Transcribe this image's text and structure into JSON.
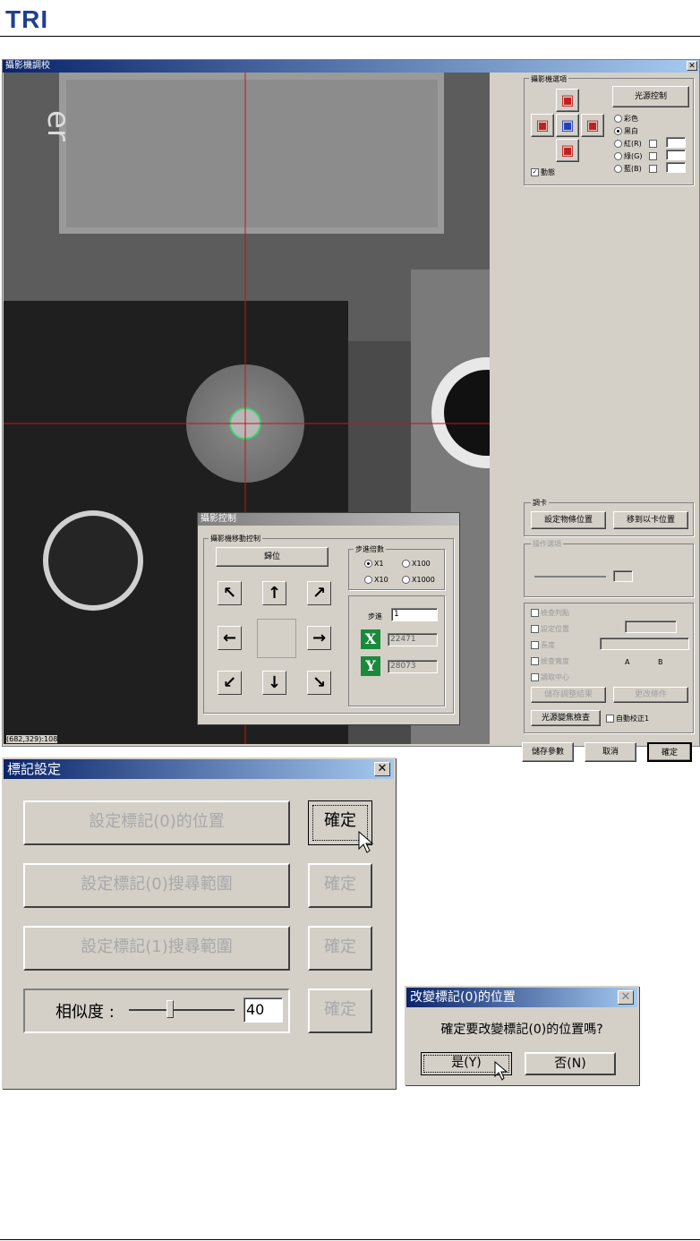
{
  "header": {
    "logo": "TRI"
  },
  "main_window": {
    "title": "攝影機調校",
    "status": "(682,329):108",
    "camera_options": {
      "group_label": "攝影機選項",
      "light_button": "光源控制",
      "color_modes": [
        "彩色",
        "黑白",
        "紅(R)",
        "綠(G)",
        "藍(B)"
      ],
      "selected_mode": "黑白",
      "dynamic_label": "動態"
    },
    "calibration": {
      "group_label": "調卡",
      "set_position_button": "設定物條位置",
      "move_center_button": "移到以卡位置"
    },
    "tool_group": {
      "label": "操作選項",
      "options": [
        "檢查判點",
        "設定位置",
        "長度",
        "檢查寬度",
        "讀取中心"
      ],
      "labels_ab": [
        "A",
        "B"
      ],
      "disabled_btn1": "儲存調整結果",
      "disabled_btn2": "更改條件",
      "light_test_button": "光源變焦檢查",
      "auto_label": "自動校正1"
    },
    "bottom_buttons": {
      "save": "儲存參數",
      "cancel": "取消",
      "ok": "確定"
    }
  },
  "motion_dialog": {
    "title": "攝影控制",
    "group_label": "攝影機移動控制",
    "home_button": "歸位",
    "step_group_label": "步進倍數",
    "step_options": [
      "X1",
      "X100",
      "X10",
      "X1000"
    ],
    "step_selected": "X1",
    "step_label": "步進",
    "step_value": "1",
    "x_label": "X",
    "x_value": "22471",
    "y_label": "Y",
    "y_value": "28073",
    "arrows": [
      "↖",
      "↑",
      "↗",
      "←",
      "→",
      "↙",
      "↓",
      "↘"
    ]
  },
  "mark_dialog": {
    "title": "標記設定",
    "row1_label": "設定標記(0)的位置",
    "row2_label": "設定標記(0)搜尋範圍",
    "row3_label": "設定標記(1)搜尋範圍",
    "similarity_label": "相似度 :",
    "similarity_value": "40",
    "ok_label": "確定"
  },
  "confirm_dialog": {
    "title": "改變標記(0)的位置",
    "message": "確定要改變標記(0)的位置嗎?",
    "yes": "是(Y)",
    "no": "否(N)"
  }
}
